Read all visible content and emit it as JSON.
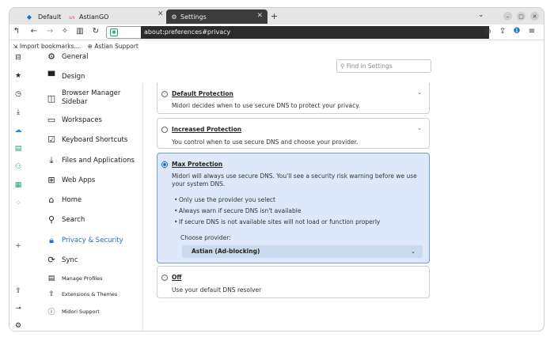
{
  "tabs": [
    {
      "label": "Default",
      "icon": "midori-icon"
    },
    {
      "label": "AstianGO",
      "icon": "astian-icon"
    },
    {
      "label": "Settings",
      "icon": "gear-icon",
      "active": true
    }
  ],
  "new_tab_glyph": "+",
  "window_controls": {
    "menu_glyph": "⌄",
    "min_glyph": "–",
    "max_glyph": "▢",
    "close_glyph": "✕"
  },
  "url": "about:preferences#privacy",
  "bookmarks": [
    "Import bookmarks...",
    "Astian Support"
  ],
  "find_placeholder": "Find in Settings",
  "sidebar": {
    "items": [
      {
        "label": "General",
        "icon": "gear-icon"
      },
      {
        "label": "Design",
        "icon": "paint-roller-icon"
      },
      {
        "label": "Browser Manager Sidebar",
        "icon": "sidebar-icon"
      },
      {
        "label": "Workspaces",
        "icon": "workspaces-icon"
      },
      {
        "label": "Keyboard Shortcuts",
        "icon": "keyboard-check-icon"
      },
      {
        "label": "Files and Applications",
        "icon": "download-icon"
      },
      {
        "label": "Web Apps",
        "icon": "web-apps-icon"
      },
      {
        "label": "Home",
        "icon": "home-icon"
      },
      {
        "label": "Search",
        "icon": "search-icon"
      },
      {
        "label": "Privacy & Security",
        "icon": "lock-icon",
        "active": true
      },
      {
        "label": "Sync",
        "icon": "sync-icon"
      }
    ],
    "footer": [
      {
        "label": "Manage Profiles",
        "icon": "profiles-icon"
      },
      {
        "label": "Extensions & Themes",
        "icon": "puzzle-icon"
      },
      {
        "label": "Midori Support",
        "icon": "help-icon"
      }
    ]
  },
  "dns": {
    "options": [
      {
        "title": "Default Protection",
        "desc": "Midori decides when to use secure DNS to protect your privacy.",
        "selected": false
      },
      {
        "title": "Increased Protection",
        "desc": "You control when to use secure DNS and choose your provider.",
        "selected": false
      },
      {
        "title": "Max Protection",
        "desc": "Midori will always use secure DNS. You'll see a security risk warning before we use your system DNS.",
        "selected": true,
        "bullets": [
          "Only use the provider you select",
          "Always warn if secure DNS isn't available",
          "If secure DNS is not available sites will not load or function properly"
        ],
        "provider_label": "Choose provider:",
        "provider_value": "Astian (Ad-blocking)"
      },
      {
        "title": "Off",
        "desc": "Use your default DNS resolver",
        "selected": false
      }
    ]
  },
  "colors": {
    "accent": "#1f6ec8",
    "selected_bg": "#dde9fb"
  }
}
